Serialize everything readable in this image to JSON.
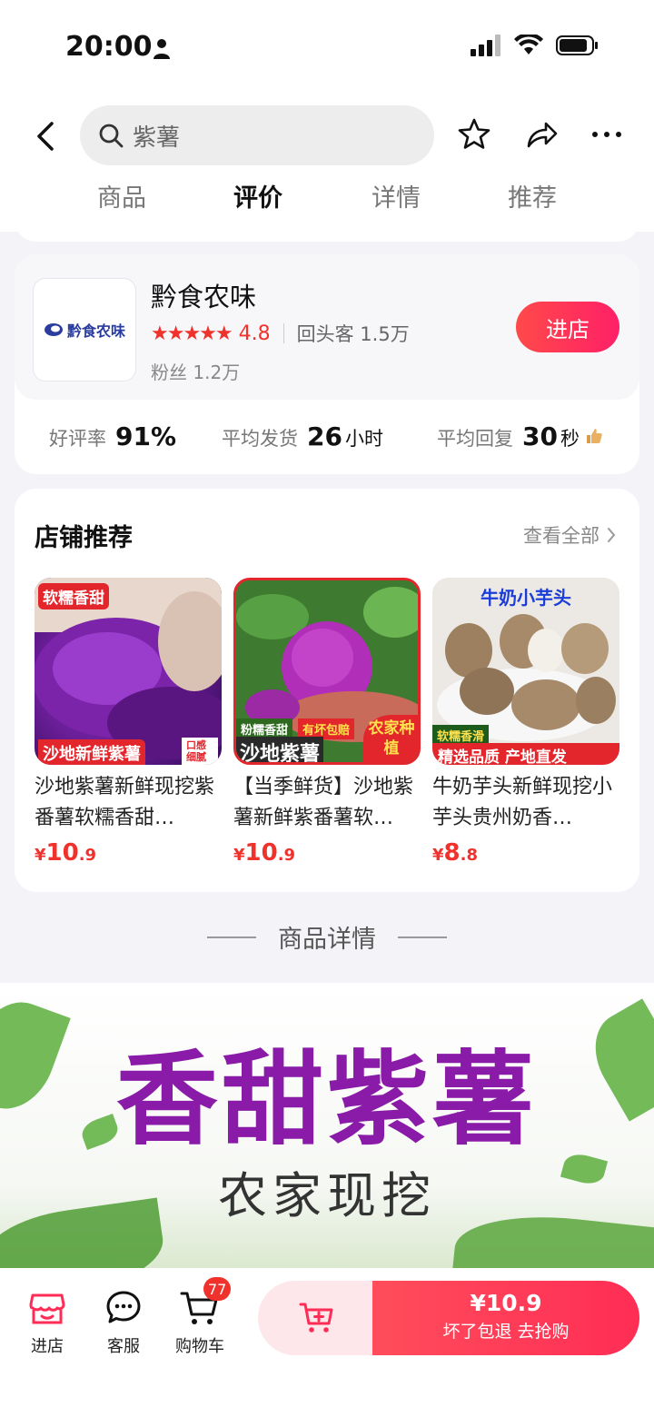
{
  "status_bar": {
    "time": "20:00"
  },
  "header": {
    "search_query": "紫薯",
    "tabs": [
      {
        "label": "商品"
      },
      {
        "label": "评价"
      },
      {
        "label": "详情"
      },
      {
        "label": "推荐"
      }
    ],
    "active_tab": "评价"
  },
  "shop": {
    "logo_text": "黔食农味",
    "name": "黔食农味",
    "stars": "★★★★★",
    "rating": "4.8",
    "repeat_customers": "回头客 1.5万",
    "fans": "粉丝 1.2万",
    "enter_label": "进店",
    "stats": [
      {
        "label": "好评率",
        "value": "91%",
        "unit": ""
      },
      {
        "label": "平均发货",
        "value": "26",
        "unit": "小时"
      },
      {
        "label": "平均回复",
        "value": "30",
        "unit": "秒"
      }
    ]
  },
  "recommend": {
    "title": "店铺推荐",
    "more": "查看全部",
    "products": [
      {
        "name": "沙地紫薯新鲜现挖紫番薯软糯香甜…",
        "price_int": "10",
        "price_dec": ".9",
        "tags": [
          "软糯香甜",
          "沙地新鲜紫薯",
          "口感细腻"
        ]
      },
      {
        "name": "【当季鲜货】沙地紫薯新鲜紫番薯软…",
        "price_int": "10",
        "price_dec": ".9",
        "tags": [
          "粉糯香甜",
          "有坏包赔",
          "沙地紫薯",
          "农家种植"
        ]
      },
      {
        "name": "牛奶芋头新鲜现挖小芋头贵州奶香…",
        "price_int": "8",
        "price_dec": ".8",
        "tags": [
          "牛奶小芋头",
          "软糯香滑",
          "精选品质 产地直发"
        ]
      }
    ],
    "currency": "¥"
  },
  "detail_section": {
    "title": "商品详情",
    "banner_title": "香甜紫薯",
    "banner_subtitle": "农家现挖"
  },
  "bottom_bar": {
    "shop_label": "进店",
    "service_label": "客服",
    "cart_label": "购物车",
    "cart_count": "77",
    "buy_price": "¥10.9",
    "buy_label": "坏了包退  去抢购"
  },
  "colors": {
    "accent": "#ff2d55",
    "price": "#f0322d",
    "purple": "#8a1aa8"
  }
}
